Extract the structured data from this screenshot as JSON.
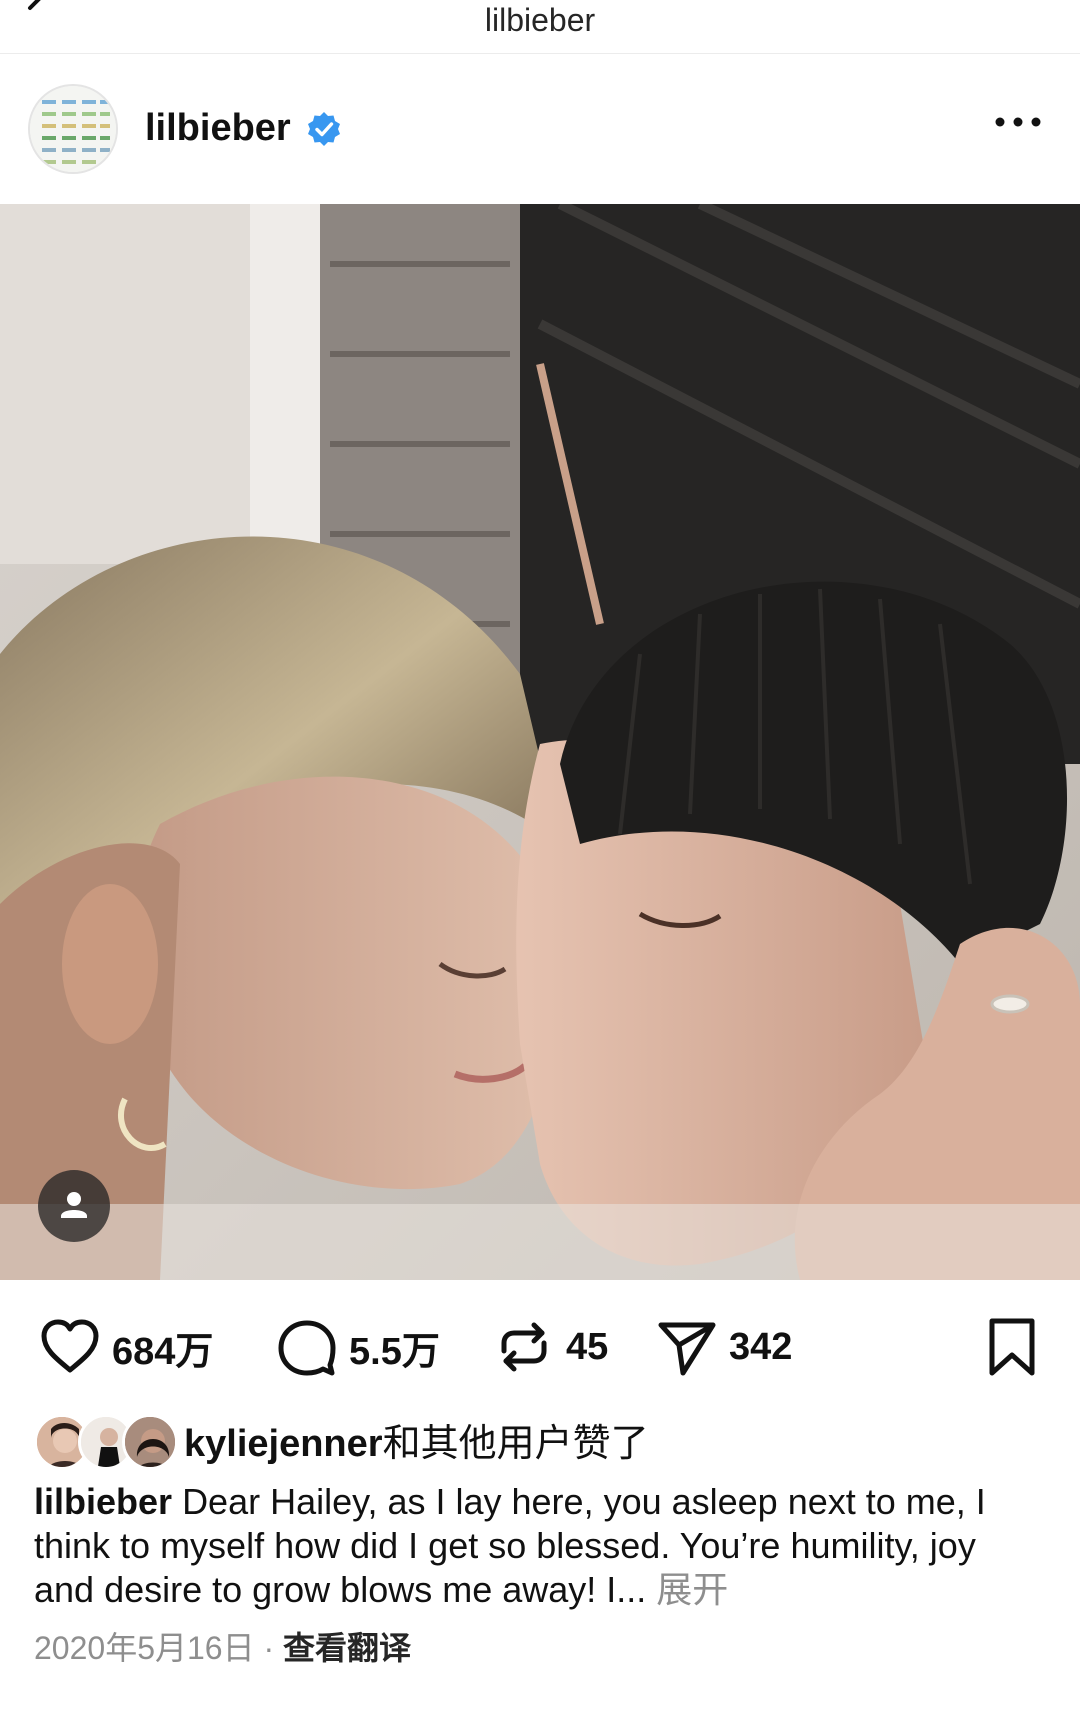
{
  "topbar": {
    "title": "lilbieber"
  },
  "post": {
    "username": "lilbieber",
    "verified": true,
    "accent_color": "#3897f0"
  },
  "actions": {
    "likes": "684万",
    "comments": "5.5万",
    "reposts": "45",
    "shares": "342"
  },
  "likes_row": {
    "user": "kyliejenner",
    "suffix": "和其他用户赞了"
  },
  "caption": {
    "username": "lilbieber",
    "text": "Dear Hailey, as I lay here, you asleep next to me, I think to myself how did I get so blessed. You’re humility, joy and desire to grow blows me away! I...",
    "expand": "展开"
  },
  "meta": {
    "date": "2020年5月16日",
    "separator": "·",
    "translate": "查看翻译"
  },
  "icons": {
    "back": "chevron-left-icon",
    "verified": "verified-badge-icon",
    "more": "more-dots-icon",
    "tag": "user-tag-icon",
    "like": "heart-icon",
    "comment": "comment-bubble-icon",
    "repost": "repost-icon",
    "share": "send-icon",
    "bookmark": "bookmark-icon"
  }
}
